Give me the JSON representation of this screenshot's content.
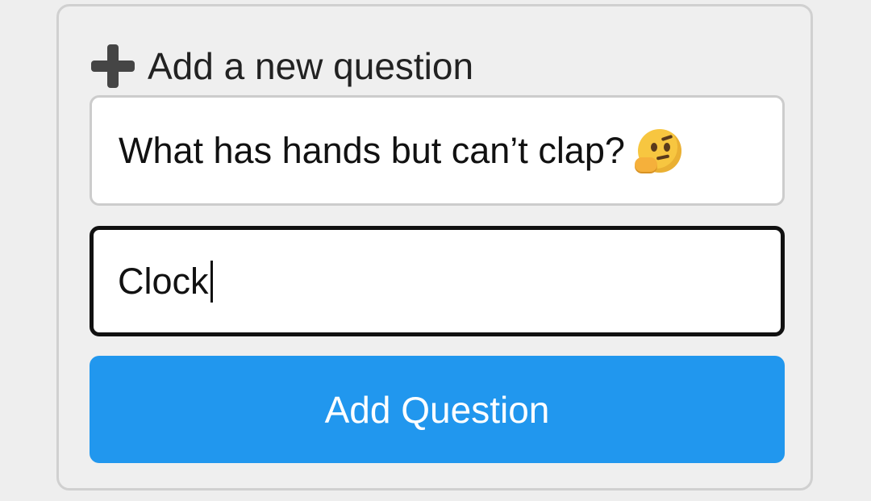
{
  "form": {
    "heading_icon": "plus-icon",
    "heading": "Add a new question",
    "question_value": "What has hands but can’t clap?",
    "question_emoji_icon": "thinking-face-icon",
    "answer_value": "Clock",
    "button_label": "Add Question"
  },
  "colors": {
    "background": "#eeeeee",
    "card_border": "#d0d0d0",
    "button": "#2197ee",
    "focused_border": "#111111"
  }
}
